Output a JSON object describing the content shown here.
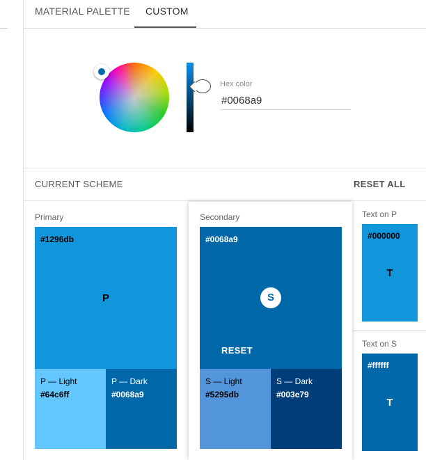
{
  "tabs": {
    "material_palette": "MATERIAL PALETTE",
    "custom": "CUSTOM"
  },
  "picker": {
    "hex_label": "Hex color",
    "hex_value": "#0068a9"
  },
  "scheme": {
    "title": "CURRENT SCHEME",
    "reset_all": "RESET ALL"
  },
  "primary": {
    "label": "Primary",
    "main_hex": "#1296db",
    "main_letter": "P",
    "light_label": "P — Light",
    "light_hex": "#64c6ff",
    "dark_label": "P — Dark",
    "dark_hex": "#0068a9"
  },
  "secondary": {
    "label": "Secondary",
    "main_hex": "#0068a9",
    "main_letter": "S",
    "reset": "RESET",
    "light_label": "S — Light",
    "light_hex": "#5295db",
    "dark_label": "S — Dark",
    "dark_hex": "#003e79"
  },
  "text_on_p": {
    "label": "Text on P",
    "hex": "#000000",
    "letter": "T"
  },
  "text_on_s": {
    "label": "Text on S",
    "hex": "#ffffff",
    "letter": "T"
  },
  "colors": {
    "primary": "#1296db",
    "primary_light": "#64c6ff",
    "primary_dark": "#0068a9",
    "secondary": "#0068a9",
    "secondary_light": "#5295db",
    "secondary_dark": "#003e79"
  }
}
